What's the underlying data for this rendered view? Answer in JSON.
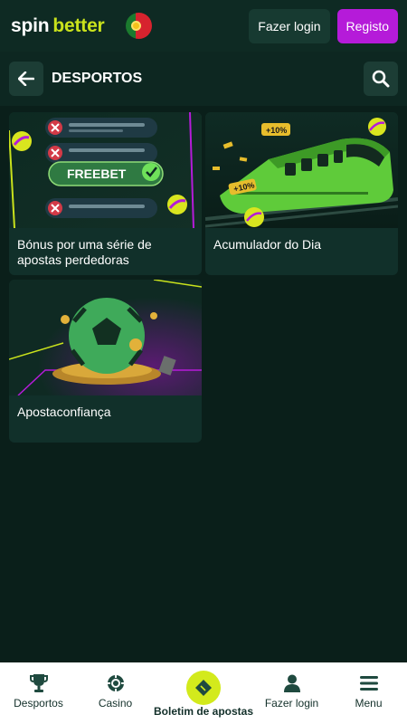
{
  "header": {
    "logo_spin": "spin",
    "logo_better": "better",
    "login_label": "Fazer login",
    "register_label": "Registo"
  },
  "section": {
    "title": "DESPORTOS"
  },
  "promos": [
    {
      "title": "Bónus por uma série de apostas perdedoras",
      "badge": "FREEBET"
    },
    {
      "title": "Acumulador do Dia",
      "tag_a": "+10%",
      "tag_b": "+10%"
    },
    {
      "title": "Apostaconfiança"
    }
  ],
  "nav": [
    {
      "label": "Desportos",
      "icon": "trophy-icon"
    },
    {
      "label": "Casino",
      "icon": "casino-chip-icon"
    },
    {
      "label": "Boletim de apostas",
      "icon": "ticket-icon"
    },
    {
      "label": "Fazer login",
      "icon": "user-icon"
    },
    {
      "label": "Menu",
      "icon": "hamburger-icon"
    }
  ],
  "colors": {
    "background": "#0a1f1a",
    "brand_accent": "#c9e21c",
    "register": "#b51bd9"
  }
}
